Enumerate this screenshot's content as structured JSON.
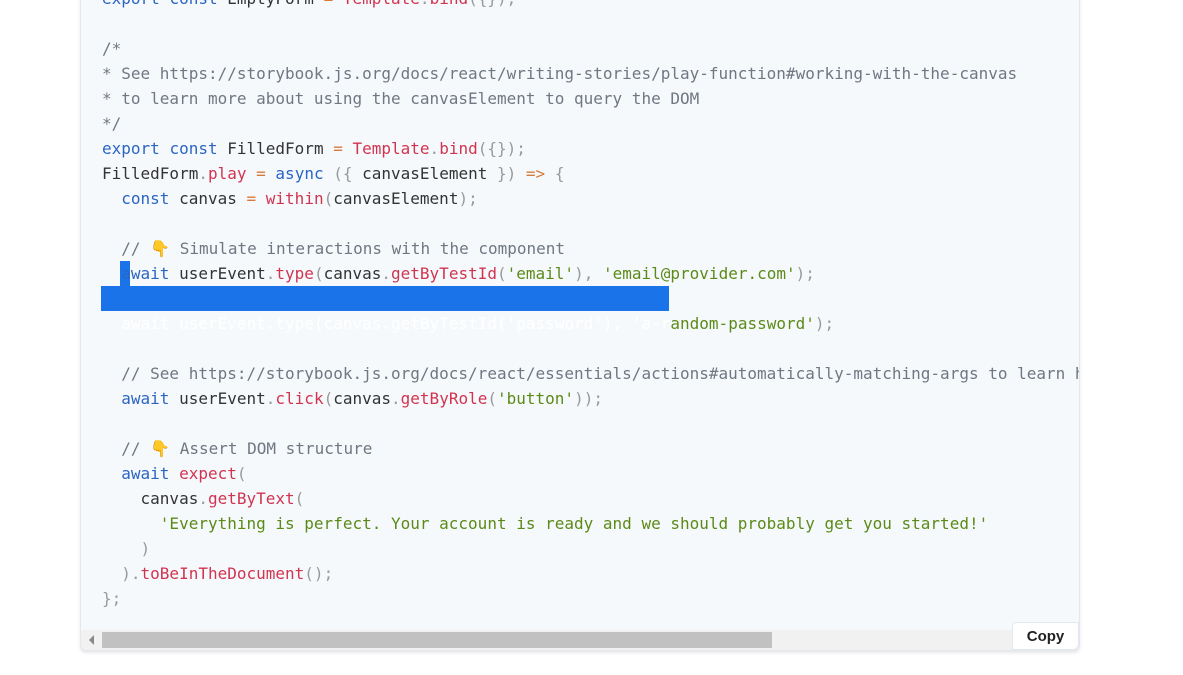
{
  "code_block": {
    "selection": {
      "line": 13,
      "text": "await userEvent.type(canvas.getByTestId('password'), 'a-r"
    },
    "lines": [
      [
        [
          "keyword",
          "export"
        ],
        [
          "plain",
          " "
        ],
        [
          "keyword",
          "const"
        ],
        [
          "plain",
          " EmptyForm "
        ],
        [
          "op",
          "="
        ],
        [
          "plain",
          " "
        ],
        [
          "fn",
          "Template"
        ],
        [
          "punct",
          "."
        ],
        [
          "fn",
          "bind"
        ],
        [
          "punct",
          "({});"
        ]
      ],
      [],
      [
        [
          "comment",
          "/*"
        ]
      ],
      [
        [
          "comment",
          "* See https://storybook.js.org/docs/react/writing-stories/play-function#working-with-the-canvas"
        ]
      ],
      [
        [
          "comment",
          "* to learn more about using the canvasElement to query the DOM"
        ]
      ],
      [
        [
          "comment",
          "*/"
        ]
      ],
      [
        [
          "keyword",
          "export"
        ],
        [
          "plain",
          " "
        ],
        [
          "keyword",
          "const"
        ],
        [
          "plain",
          " FilledForm "
        ],
        [
          "op",
          "="
        ],
        [
          "plain",
          " "
        ],
        [
          "fn",
          "Template"
        ],
        [
          "punct",
          "."
        ],
        [
          "fn",
          "bind"
        ],
        [
          "punct",
          "({});"
        ]
      ],
      [
        [
          "plain",
          "FilledForm"
        ],
        [
          "punct",
          "."
        ],
        [
          "fn",
          "play"
        ],
        [
          "plain",
          " "
        ],
        [
          "op",
          "="
        ],
        [
          "plain",
          " "
        ],
        [
          "keyword",
          "async"
        ],
        [
          "plain",
          " "
        ],
        [
          "punct",
          "({"
        ],
        [
          "plain",
          " canvasElement "
        ],
        [
          "punct",
          "})"
        ],
        [
          "plain",
          " "
        ],
        [
          "op",
          "=>"
        ],
        [
          "plain",
          " "
        ],
        [
          "punct",
          "{"
        ]
      ],
      [
        [
          "plain",
          "  "
        ],
        [
          "keyword",
          "const"
        ],
        [
          "plain",
          " canvas "
        ],
        [
          "op",
          "="
        ],
        [
          "plain",
          " "
        ],
        [
          "fn",
          "within"
        ],
        [
          "punct",
          "("
        ],
        [
          "plain",
          "canvasElement"
        ],
        [
          "punct",
          ");"
        ]
      ],
      [],
      [
        [
          "comment",
          "  // 👇 Simulate interactions with the component"
        ]
      ],
      [
        [
          "plain",
          "  "
        ],
        [
          "keyword",
          "await"
        ],
        [
          "plain",
          " userEvent"
        ],
        [
          "punct",
          "."
        ],
        [
          "fn",
          "type"
        ],
        [
          "punct",
          "("
        ],
        [
          "plain",
          "canvas"
        ],
        [
          "punct",
          "."
        ],
        [
          "fn",
          "getByTestId"
        ],
        [
          "punct",
          "("
        ],
        [
          "str",
          "'email'"
        ],
        [
          "punct",
          "),"
        ],
        [
          "plain",
          " "
        ],
        [
          "str",
          "'email@provider.com'"
        ],
        [
          "punct",
          ");"
        ]
      ],
      [],
      [
        [
          "plain",
          "  "
        ],
        [
          "keyword",
          "await"
        ],
        [
          "plain",
          " userEvent"
        ],
        [
          "punct",
          "."
        ],
        [
          "fn",
          "type"
        ],
        [
          "punct",
          "("
        ],
        [
          "plain",
          "canvas"
        ],
        [
          "punct",
          "."
        ],
        [
          "fn",
          "getByTestId"
        ],
        [
          "punct",
          "("
        ],
        [
          "str",
          "'password'"
        ],
        [
          "punct",
          "),"
        ],
        [
          "plain",
          " "
        ],
        [
          "str",
          "'a-random-password'"
        ],
        [
          "punct",
          ");"
        ]
      ],
      [],
      [
        [
          "comment",
          "  // See https://storybook.js.org/docs/react/essentials/actions#automatically-matching-args to learn h"
        ]
      ],
      [
        [
          "plain",
          "  "
        ],
        [
          "keyword",
          "await"
        ],
        [
          "plain",
          " userEvent"
        ],
        [
          "punct",
          "."
        ],
        [
          "fn",
          "click"
        ],
        [
          "punct",
          "("
        ],
        [
          "plain",
          "canvas"
        ],
        [
          "punct",
          "."
        ],
        [
          "fn",
          "getByRole"
        ],
        [
          "punct",
          "("
        ],
        [
          "str",
          "'button'"
        ],
        [
          "punct",
          "));"
        ]
      ],
      [],
      [
        [
          "comment",
          "  // 👇 Assert DOM structure"
        ]
      ],
      [
        [
          "plain",
          "  "
        ],
        [
          "keyword",
          "await"
        ],
        [
          "plain",
          " "
        ],
        [
          "fn",
          "expect"
        ],
        [
          "punct",
          "("
        ]
      ],
      [
        [
          "plain",
          "    canvas"
        ],
        [
          "punct",
          "."
        ],
        [
          "fn",
          "getByText"
        ],
        [
          "punct",
          "("
        ]
      ],
      [
        [
          "plain",
          "      "
        ],
        [
          "str",
          "'Everything is perfect. Your account is ready and we should probably get you started!'"
        ]
      ],
      [
        [
          "punct",
          "    )"
        ]
      ],
      [
        [
          "punct",
          "  )."
        ],
        [
          "fn",
          "toBeInTheDocument"
        ],
        [
          "punct",
          "();"
        ]
      ],
      [
        [
          "punct",
          "};"
        ]
      ]
    ]
  },
  "copy_button": {
    "label": "Copy"
  },
  "scrollbar": {
    "position_fraction": 0.0,
    "visible_fraction": 0.69
  }
}
